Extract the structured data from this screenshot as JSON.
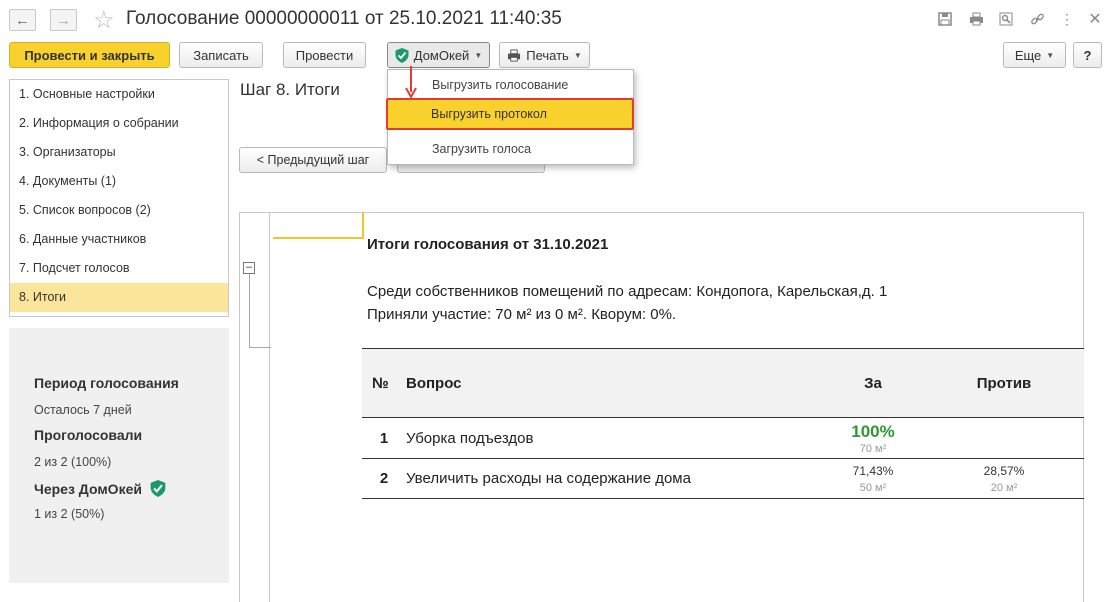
{
  "window": {
    "title": "Голосование 00000000011 от 25.10.2021 11:40:35"
  },
  "toolbar": {
    "post_close": "Провести и закрыть",
    "write": "Записать",
    "post": "Провести",
    "domokey": "ДомОкей",
    "print": "Печать",
    "more": "Еще",
    "help": "?"
  },
  "dropdown": {
    "items": [
      "Выгрузить голосование",
      "Выгрузить протокол",
      "Загрузить голоса"
    ]
  },
  "sidebar": {
    "items": [
      "1. Основные настройки",
      "2. Информация о собрании",
      "3. Организаторы",
      "4. Документы (1)",
      "5. Список вопросов (2)",
      "6. Данные участников",
      "7. Подсчет голосов",
      "8. Итоги"
    ]
  },
  "stats": {
    "period_label": "Период голосования",
    "period_value": "Осталось 7 дней",
    "voted_label": "Проголосовали",
    "voted_value": "2 из 2 (100%)",
    "via_label": "Через ДомОкей",
    "via_value": "1 из 2 (50%)"
  },
  "main": {
    "step_title": "Шаг 8. Итоги",
    "prev_button": "< Предыдущий шаг"
  },
  "report": {
    "title": "Итоги голосования от 31.10.2021",
    "line1": "Среди собственников помещений по адресам: Кондопога, Карельская,д. 1",
    "line2": "Приняли участие: 70 м² из 0 м². Кворум: 0%.",
    "headers": {
      "num": "№",
      "question": "Вопрос",
      "for": "За",
      "against": "Против"
    },
    "rows": [
      {
        "num": "1",
        "question": "Уборка подъездов",
        "for_pct": "100%",
        "for_area": "70 м²",
        "against_pct": "",
        "against_area": ""
      },
      {
        "num": "2",
        "question": "Увеличить расходы на содержание дома",
        "for_pct": "71,43%",
        "for_area": "50 м²",
        "against_pct": "28,57%",
        "against_area": "20 м²"
      }
    ]
  },
  "colors": {
    "accent_yellow": "#f9d12d",
    "selection": "#fbe59b",
    "highlight_border": "#e43c34",
    "brand_green": "#1a9a6a",
    "percent_green": "#2e9a2e"
  }
}
